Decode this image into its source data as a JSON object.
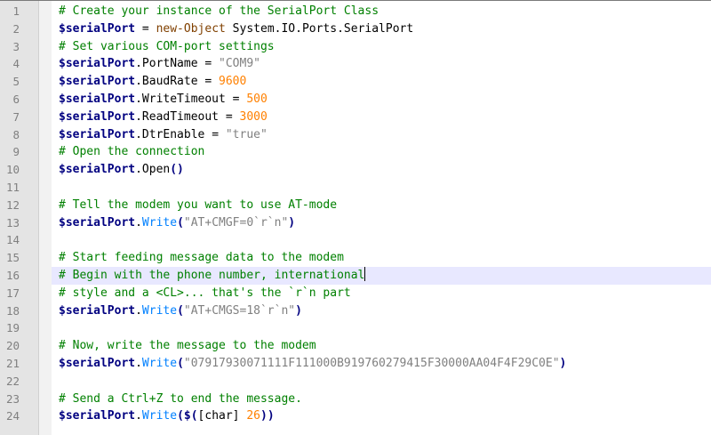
{
  "editor": {
    "current_line": 16,
    "lines": [
      {
        "n": "1",
        "tokens": [
          {
            "t": "cmt",
            "v": "# Create your instance of the SerialPort Class"
          }
        ]
      },
      {
        "n": "2",
        "tokens": [
          {
            "t": "var",
            "v": "$serialPort"
          },
          {
            "t": "op",
            "v": " = "
          },
          {
            "t": "kw",
            "v": "new-Object"
          },
          {
            "t": "plain",
            "v": " System.IO.Ports.SerialPort"
          }
        ]
      },
      {
        "n": "3",
        "tokens": [
          {
            "t": "cmt",
            "v": "# Set various COM-port settings"
          }
        ]
      },
      {
        "n": "4",
        "tokens": [
          {
            "t": "var",
            "v": "$serialPort"
          },
          {
            "t": "plain",
            "v": ".PortName"
          },
          {
            "t": "op",
            "v": " = "
          },
          {
            "t": "str",
            "v": "\"COM9\""
          }
        ]
      },
      {
        "n": "5",
        "tokens": [
          {
            "t": "var",
            "v": "$serialPort"
          },
          {
            "t": "plain",
            "v": ".BaudRate"
          },
          {
            "t": "op",
            "v": " = "
          },
          {
            "t": "num",
            "v": "9600"
          }
        ]
      },
      {
        "n": "6",
        "tokens": [
          {
            "t": "var",
            "v": "$serialPort"
          },
          {
            "t": "plain",
            "v": ".WriteTimeout"
          },
          {
            "t": "op",
            "v": " = "
          },
          {
            "t": "num",
            "v": "500"
          }
        ]
      },
      {
        "n": "7",
        "tokens": [
          {
            "t": "var",
            "v": "$serialPort"
          },
          {
            "t": "plain",
            "v": ".ReadTimeout"
          },
          {
            "t": "op",
            "v": " = "
          },
          {
            "t": "num",
            "v": "3000"
          }
        ]
      },
      {
        "n": "8",
        "tokens": [
          {
            "t": "var",
            "v": "$serialPort"
          },
          {
            "t": "plain",
            "v": ".DtrEnable"
          },
          {
            "t": "op",
            "v": " = "
          },
          {
            "t": "str",
            "v": "\"true\""
          }
        ]
      },
      {
        "n": "9",
        "tokens": [
          {
            "t": "cmt",
            "v": "# Open the connection"
          }
        ]
      },
      {
        "n": "10",
        "tokens": [
          {
            "t": "var",
            "v": "$serialPort"
          },
          {
            "t": "plain",
            "v": ".Open"
          },
          {
            "t": "par",
            "v": "()"
          }
        ]
      },
      {
        "n": "11",
        "tokens": []
      },
      {
        "n": "12",
        "tokens": [
          {
            "t": "cmt",
            "v": "# Tell the modem you want to use AT-mode"
          }
        ]
      },
      {
        "n": "13",
        "tokens": [
          {
            "t": "var",
            "v": "$serialPort"
          },
          {
            "t": "plain",
            "v": "."
          },
          {
            "t": "mth",
            "v": "Write"
          },
          {
            "t": "par",
            "v": "("
          },
          {
            "t": "str",
            "v": "\"AT+CMGF=0`r`n\""
          },
          {
            "t": "par",
            "v": ")"
          }
        ]
      },
      {
        "n": "14",
        "tokens": []
      },
      {
        "n": "15",
        "tokens": [
          {
            "t": "cmt",
            "v": "# Start feeding message data to the modem"
          }
        ]
      },
      {
        "n": "16",
        "tokens": [
          {
            "t": "cmt",
            "v": "# Begin with the phone number, international"
          }
        ]
      },
      {
        "n": "17",
        "tokens": [
          {
            "t": "cmt",
            "v": "# style and a <CL>... that's the `r`n part"
          }
        ]
      },
      {
        "n": "18",
        "tokens": [
          {
            "t": "var",
            "v": "$serialPort"
          },
          {
            "t": "plain",
            "v": "."
          },
          {
            "t": "mth",
            "v": "Write"
          },
          {
            "t": "par",
            "v": "("
          },
          {
            "t": "str",
            "v": "\"AT+CMGS=18`r`n\""
          },
          {
            "t": "par",
            "v": ")"
          }
        ]
      },
      {
        "n": "19",
        "tokens": []
      },
      {
        "n": "20",
        "tokens": [
          {
            "t": "cmt",
            "v": "# Now, write the message to the modem"
          }
        ]
      },
      {
        "n": "21",
        "tokens": [
          {
            "t": "var",
            "v": "$serialPort"
          },
          {
            "t": "plain",
            "v": "."
          },
          {
            "t": "mth",
            "v": "Write"
          },
          {
            "t": "par",
            "v": "("
          },
          {
            "t": "str",
            "v": "\"07917930071111F111000B919760279415F30000AA04F4F29C0E\""
          },
          {
            "t": "par",
            "v": ")"
          }
        ]
      },
      {
        "n": "22",
        "tokens": []
      },
      {
        "n": "23",
        "tokens": [
          {
            "t": "cmt",
            "v": "# Send a Ctrl+Z to end the message."
          }
        ]
      },
      {
        "n": "24",
        "tokens": [
          {
            "t": "var",
            "v": "$serialPort"
          },
          {
            "t": "plain",
            "v": "."
          },
          {
            "t": "mth",
            "v": "Write"
          },
          {
            "t": "par",
            "v": "($("
          },
          {
            "t": "plain",
            "v": "[char]"
          },
          {
            "t": "plain",
            "v": " "
          },
          {
            "t": "num",
            "v": "26"
          },
          {
            "t": "par",
            "v": "))"
          }
        ]
      }
    ]
  },
  "colors": {
    "comment": "#008000",
    "variable": "#000080",
    "keyword": "#804000",
    "string": "#808080",
    "number": "#ff8000",
    "method": "#0080ff",
    "current_line_bg": "#e8e8ff",
    "gutter_bg": "#e4e4e4"
  }
}
